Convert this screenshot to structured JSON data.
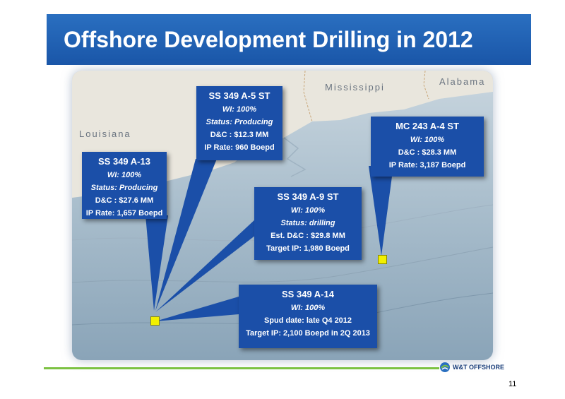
{
  "slide": {
    "title": "Offshore Development Drilling in 2012",
    "page_number": "11",
    "logo_text": "W&T OFFSHORE"
  },
  "map": {
    "labels": {
      "mississippi": "Mississippi",
      "alabama": "Alabama",
      "louisiana": "Louisiana"
    }
  },
  "wells": [
    {
      "id": "a13",
      "name": "SS 349  A-13",
      "wi": "WI: 100%",
      "status": "Status: Producing",
      "cost": "D&C : $27.6 MM",
      "rate": "IP Rate: 1,657 Boepd"
    },
    {
      "id": "a5st",
      "name": "SS 349  A-5 ST",
      "wi": "WI: 100%",
      "status": "Status: Producing",
      "cost": "D&C : $12.3 MM",
      "rate": "IP Rate: 960 Boepd"
    },
    {
      "id": "a9st",
      "name": "SS 349  A-9 ST",
      "wi": "WI: 100%",
      "status": "Status: drilling",
      "cost": "Est. D&C : $29.8 MM",
      "rate": "Target  IP: 1,980 Boepd"
    },
    {
      "id": "mc243",
      "name": "MC 243  A-4 ST",
      "wi": "WI: 100%",
      "cost": "D&C : $28.3 MM",
      "rate": "IP Rate:  3,187 Boepd"
    },
    {
      "id": "a14",
      "name": "SS 349  A-14",
      "wi": "WI: 100%",
      "status": "Spud date: late Q4 2012",
      "rate": "Target IP: 2,100 Boepd in 2Q 2013"
    }
  ],
  "colors": {
    "title_bar": "#1a56a8",
    "callout": "#1b4fa8",
    "marker": "#f2f000",
    "accent_line": "#7cc242"
  }
}
